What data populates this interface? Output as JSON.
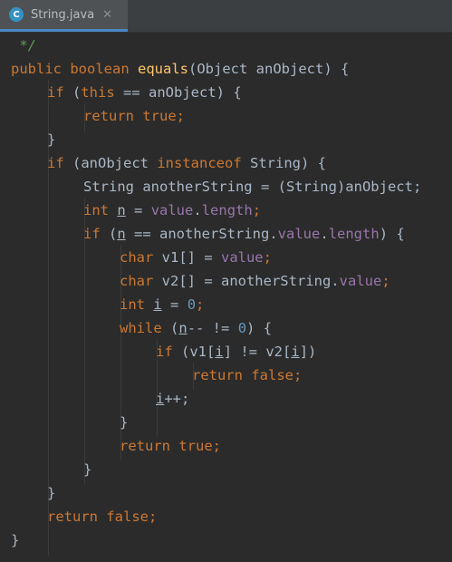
{
  "tab": {
    "title": "String.java",
    "icon_letter": "C",
    "close_glyph": "✕",
    "icon": "java-class-icon"
  },
  "code": {
    "l0_comment": " */",
    "l1_public": "public",
    "l1_boolean": "boolean",
    "l1_equals": "equals",
    "l1_rest": "(Object anObject) {",
    "l2_if": "if",
    "l2_open": " (",
    "l2_this": "this",
    "l2_rest": " == anObject) {",
    "l3_return": "return",
    "l3_true": "true",
    "l3_semi": ";",
    "l4_brace": "}",
    "l5_if": "if",
    "l5_a": " (anObject ",
    "l5_instanceof": "instanceof",
    "l5_b": " String) {",
    "l6_text": "String anotherString = (String)anObject;",
    "l7_int": "int",
    "l7_n": "n",
    "l7_eq": " = ",
    "l7_value": "value",
    "l7_dot": ".",
    "l7_length": "length",
    "l7_semi": ";",
    "l8_if": "if",
    "l8_open": " (",
    "l8_n": "n",
    "l8_mid": " == anotherString.",
    "l8_value": "value",
    "l8_dot": ".",
    "l8_length": "length",
    "l8_close": ") {",
    "l9_char": "char",
    "l9_mid": " v1[] = ",
    "l9_value": "value",
    "l9_semi": ";",
    "l10_char": "char",
    "l10_mid": " v2[] = anotherString.",
    "l10_value": "value",
    "l10_semi": ";",
    "l11_int": "int",
    "l11_sp": " ",
    "l11_i": "i",
    "l11_eq": " = ",
    "l11_zero": "0",
    "l11_semi": ";",
    "l12_while": "while",
    "l12_open": " (",
    "l12_n": "n",
    "l12_mid": "-- != ",
    "l12_zero": "0",
    "l12_close": ") {",
    "l13_if": "if",
    "l13_a": " (v1[",
    "l13_i1": "i",
    "l13_b": "] != v2[",
    "l13_i2": "i",
    "l13_c": "])",
    "l14_return": "return",
    "l14_false": "false",
    "l14_semi": ";",
    "l15_i": "i",
    "l15_rest": "++;",
    "l16_brace": "}",
    "l17_return": "return",
    "l17_true": "true",
    "l17_semi": ";",
    "l18_brace": "}",
    "l19_brace": "}",
    "l20_return": "return",
    "l20_false": "false",
    "l20_semi": ";",
    "l21_brace": "}"
  },
  "colors": {
    "background": "#2b2b2b",
    "keyword": "#cc7832",
    "field": "#9876aa",
    "method": "#ffc66d",
    "number": "#6897bb",
    "comment": "#629755",
    "text": "#a9b7c6"
  }
}
